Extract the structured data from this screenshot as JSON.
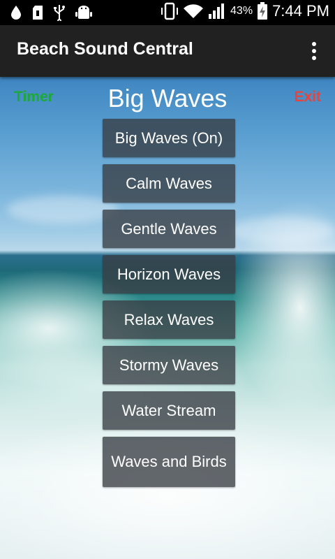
{
  "status_bar": {
    "battery_percent": "43%",
    "time": "7:44 PM",
    "icons": [
      "water-drop-icon",
      "sd-card-icon",
      "usb-icon",
      "android-debug-icon",
      "phone-vibrate-icon",
      "wifi-icon",
      "signal-icon",
      "battery-charging-icon"
    ]
  },
  "app_bar": {
    "title": "Beach Sound Central",
    "menu_icon": "overflow-menu-icon"
  },
  "main": {
    "timer_label": "Timer",
    "heading": "Big Waves",
    "exit_label": "Exit",
    "buttons": [
      "Big Waves (On)",
      "Calm Waves",
      "Gentle Waves",
      "Horizon Waves",
      "Relax Waves",
      "Stormy Waves",
      "Water Stream",
      "Waves and Birds"
    ]
  },
  "colors": {
    "timer": "#1ea83a",
    "exit": "#e8433c",
    "app_bar": "#212121"
  }
}
